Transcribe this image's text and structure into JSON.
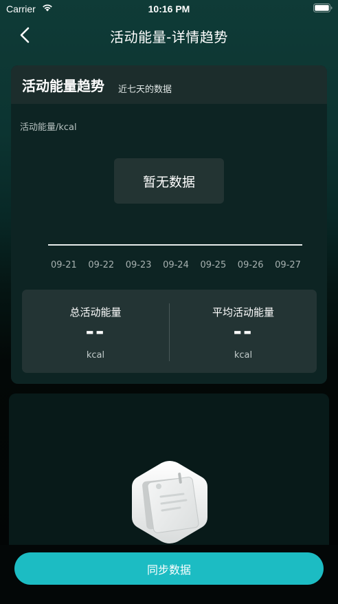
{
  "status_bar": {
    "carrier": "Carrier",
    "time": "10:16 PM"
  },
  "nav": {
    "title": "活动能量-详情趋势",
    "back_icon": "chevron-left-icon"
  },
  "trend": {
    "title": "活动能量趋势",
    "subtitle": "近七天的数据",
    "y_unit": "活动能量/kcal",
    "empty_text": "暂无数据",
    "dates": [
      "09-21",
      "09-22",
      "09-23",
      "09-24",
      "09-25",
      "09-26",
      "09-27"
    ]
  },
  "chart_data": {
    "type": "bar",
    "title": "活动能量趋势",
    "subtitle": "近七天的数据",
    "ylabel": "活动能量/kcal",
    "categories": [
      "09-21",
      "09-22",
      "09-23",
      "09-24",
      "09-25",
      "09-26",
      "09-27"
    ],
    "values": [],
    "empty_message": "暂无数据"
  },
  "stats": {
    "total_label": "总活动能量",
    "total_value": "--",
    "total_unit": "kcal",
    "avg_label": "平均活动能量",
    "avg_value": "--",
    "avg_unit": "kcal"
  },
  "empty_state": {
    "icon": "document-icon"
  },
  "actions": {
    "sync_label": "同步数据"
  },
  "colors": {
    "accent": "#1cbcc3",
    "card_bg": "#0d2423",
    "stats_bg": "#233434"
  }
}
